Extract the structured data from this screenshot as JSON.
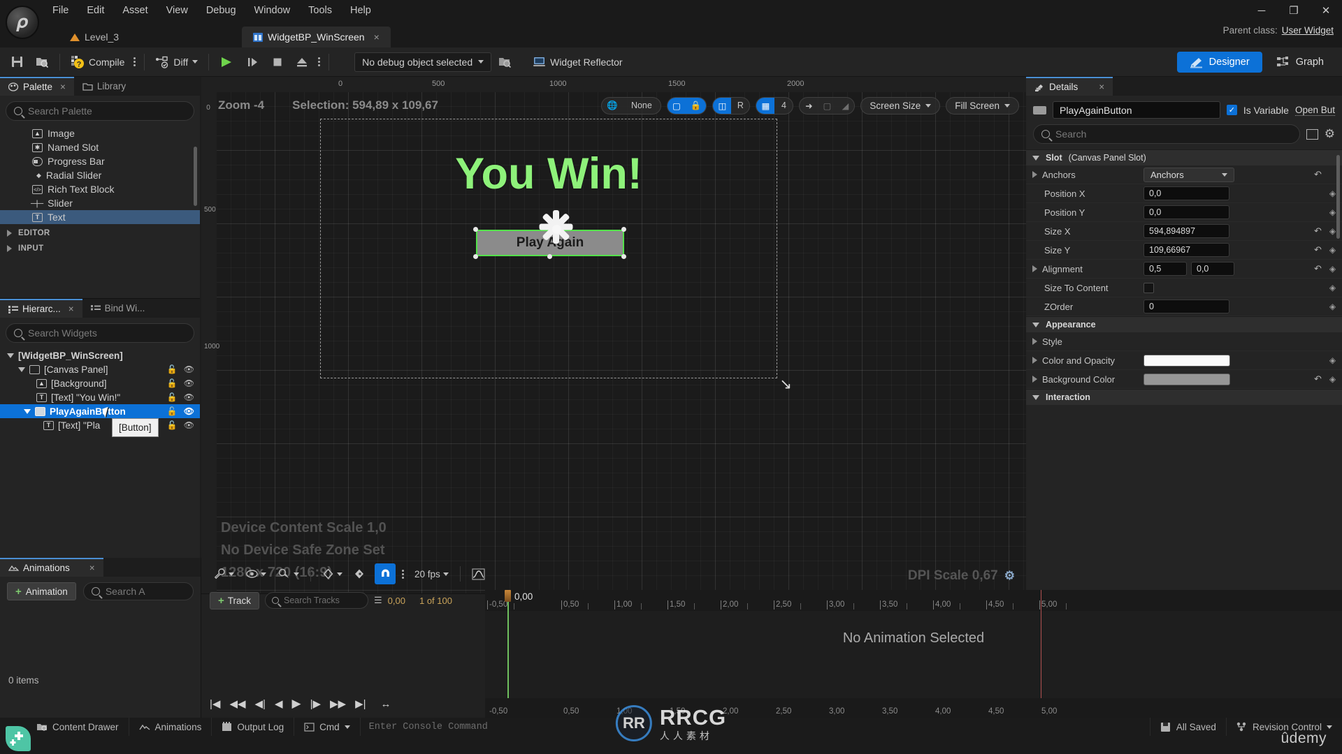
{
  "titlebar": {
    "menus": [
      "File",
      "Edit",
      "Asset",
      "View",
      "Debug",
      "Window",
      "Tools",
      "Help"
    ],
    "tabs": [
      {
        "label": "Level_3",
        "icon": "level-icon",
        "active": false
      },
      {
        "label": "WidgetBP_WinScreen",
        "icon": "widget-blueprint-icon",
        "active": true,
        "close": "×"
      }
    ],
    "parent_class_label": "Parent class:",
    "parent_class_value": "User Widget",
    "window_controls": {
      "minimize": "─",
      "maximize": "❐",
      "close": "✕"
    }
  },
  "toolbar": {
    "save_icon": "save-icon",
    "browse_icon": "browse-to-asset-icon",
    "compile_label": "Compile",
    "diff_label": "Diff",
    "play_icon": "play-icon",
    "step_icon": "step-icon",
    "stop_icon": "stop-icon",
    "eject_icon": "eject-icon",
    "debug_object": "No debug object selected",
    "widget_reflector": "Widget Reflector",
    "designer_label": "Designer",
    "graph_label": "Graph",
    "accent_blue": "#0c71d7"
  },
  "palette": {
    "tabs": [
      {
        "label": "Palette",
        "active": true,
        "close": "×",
        "icon": "palette-icon"
      },
      {
        "label": "Library",
        "active": false,
        "icon": "folder-icon"
      }
    ],
    "search_placeholder": "Search Palette",
    "items": [
      {
        "label": "Image",
        "icon": "image-icon",
        "selected": false
      },
      {
        "label": "Named Slot",
        "icon": "named-slot-icon",
        "selected": false
      },
      {
        "label": "Progress Bar",
        "icon": "progress-bar-icon",
        "selected": false
      },
      {
        "label": "Radial Slider",
        "icon": "radial-slider-icon",
        "selected": false
      },
      {
        "label": "Rich Text Block",
        "icon": "rich-text-icon",
        "selected": false
      },
      {
        "label": "Slider",
        "icon": "slider-icon",
        "selected": false
      },
      {
        "label": "Text",
        "icon": "text-icon",
        "selected": true
      }
    ],
    "categories": [
      "EDITOR",
      "INPUT"
    ]
  },
  "hierarchy": {
    "tabs": [
      {
        "label": "Hierarc...",
        "active": true,
        "close": "×",
        "icon": "hierarchy-icon"
      },
      {
        "label": "Bind Wi...",
        "active": false,
        "icon": "bind-widgets-icon"
      }
    ],
    "search_placeholder": "Search Widgets",
    "tree": [
      {
        "label": "[WidgetBP_WinScreen]",
        "depth": 0,
        "expander": "down",
        "selected": false,
        "root": true
      },
      {
        "label": "[Canvas Panel]",
        "depth": 1,
        "expander": "down",
        "selected": false,
        "icon": "canvas-panel-icon",
        "lock": true,
        "eye": true
      },
      {
        "label": "[Background]",
        "depth": 2,
        "expander": "none",
        "selected": false,
        "icon": "image-icon",
        "lock": true,
        "eye": true
      },
      {
        "label": "[Text] \"You Win!\"",
        "depth": 2,
        "expander": "none",
        "selected": false,
        "icon": "text-icon",
        "lock": true,
        "eye": true
      },
      {
        "label": "PlayAgainButton",
        "depth": 2,
        "expander": "down",
        "selected": true,
        "icon": "button-icon",
        "lock": true,
        "eye": true
      },
      {
        "label": "[Text] \"Pla",
        "depth": 3,
        "expander": "none",
        "selected": false,
        "icon": "text-icon",
        "lock": true,
        "eye": true
      }
    ],
    "tooltip": "[Button]"
  },
  "viewport": {
    "zoom_label": "Zoom -4",
    "selection_label": "Selection: 594,89 x 109,67",
    "snap_none": "None",
    "grid_value": "4",
    "screen_size": "Screen Size",
    "fill_screen": "Fill Screen",
    "rotate_label": "R",
    "ruler_top": [
      "0",
      "500",
      "1000",
      "1500",
      "2000"
    ],
    "ruler_left": [
      "0",
      "500",
      "1000"
    ],
    "canvas_title": "You Win!",
    "button_text": "Play Again",
    "title_color": "#8ef27a",
    "button_border_color": "#53e24a",
    "info_lines": [
      "Device Content Scale 1,0",
      "No Device Safe Zone Set",
      "1280 x 720 (16:9)"
    ],
    "dpi_scale": "DPI Scale 0,67"
  },
  "details": {
    "tab_label": "Details",
    "tab_close": "×",
    "widget_name": "PlayAgainButton",
    "is_variable_label": "Is Variable",
    "is_variable_checked": true,
    "open_button_label": "Open But",
    "search_placeholder": "Search",
    "sections": [
      {
        "title_bold": "Slot",
        "title_rest": "(Canvas Panel Slot)",
        "rows": [
          {
            "label": "Anchors",
            "type": "combo",
            "value": "Anchors",
            "expander": true,
            "undo": true,
            "bind": false
          },
          {
            "label": "Position X",
            "type": "text",
            "value": "0,0",
            "undo": false,
            "bind": true
          },
          {
            "label": "Position Y",
            "type": "text",
            "value": "0,0",
            "undo": false,
            "bind": true
          },
          {
            "label": "Size X",
            "type": "text",
            "value": "594,894897",
            "undo": true,
            "bind": true
          },
          {
            "label": "Size Y",
            "type": "text",
            "value": "109,66967",
            "undo": true,
            "bind": true
          },
          {
            "label": "Alignment",
            "type": "text2",
            "value": "0,5",
            "value2": "0,0",
            "expander": true,
            "undo": true,
            "bind": true
          },
          {
            "label": "Size To Content",
            "type": "checkbox",
            "value": "",
            "checked": false,
            "undo": false,
            "bind": true
          },
          {
            "label": "ZOrder",
            "type": "text",
            "value": "0",
            "undo": false,
            "bind": true
          }
        ]
      },
      {
        "title_bold": "Appearance",
        "title_rest": "",
        "rows": [
          {
            "label": "Style",
            "type": "none",
            "value": "",
            "expander": true,
            "undo": false,
            "bind": false
          },
          {
            "label": "Color and Opacity",
            "type": "swatch",
            "value": "",
            "color": "#fbfbfb",
            "expander": true,
            "undo": false,
            "bind": true
          },
          {
            "label": "Background Color",
            "type": "swatch",
            "value": "",
            "color": "#969696",
            "expander": true,
            "undo": true,
            "bind": true
          }
        ]
      },
      {
        "title_bold": "Interaction",
        "title_rest": "",
        "rows": []
      }
    ]
  },
  "animations": {
    "tab_label": "Animations",
    "tab_close": "×",
    "add_animation_label": "Animation",
    "search_placeholder": "Search A",
    "items_count": "0 items"
  },
  "sequencer": {
    "fps": "20 fps",
    "track_button": "Track",
    "track_search_placeholder": "Search Tracks",
    "current_time": "0,00",
    "frame_counter": "1 of 100",
    "playhead_value": "0,00",
    "empty_message": "No Animation Selected",
    "ruler_ticks": [
      "-0,50",
      "0,50",
      "1,00",
      "1,50",
      "2,00",
      "2,50",
      "3,00",
      "3,50",
      "4,00",
      "4,50",
      "5,00"
    ],
    "transport_icons": [
      "jump-to-start",
      "step-back-frames",
      "previous-key",
      "play-reverse",
      "play-forward",
      "next-key",
      "step-forward-frames",
      "jump-to-end",
      "loop"
    ]
  },
  "statusbar": {
    "left_items": [
      {
        "label": "Content Drawer",
        "icon": "drawer-icon"
      },
      {
        "label": "Animations",
        "icon": "animation-icon"
      },
      {
        "label": "Output Log",
        "icon": "log-icon"
      },
      {
        "label": "Cmd",
        "icon": "cmd-icon",
        "caret": true
      }
    ],
    "console_placeholder": "Enter Console Command",
    "right_items": [
      {
        "label": "All Saved",
        "icon": "save-icon"
      },
      {
        "label": "Revision Control",
        "icon": "revision-control-icon",
        "caret": true
      }
    ]
  },
  "watermark": {
    "logo_text": "RR",
    "main": "RRCG",
    "sub": "人人素材",
    "udemy": "ûdemy"
  }
}
